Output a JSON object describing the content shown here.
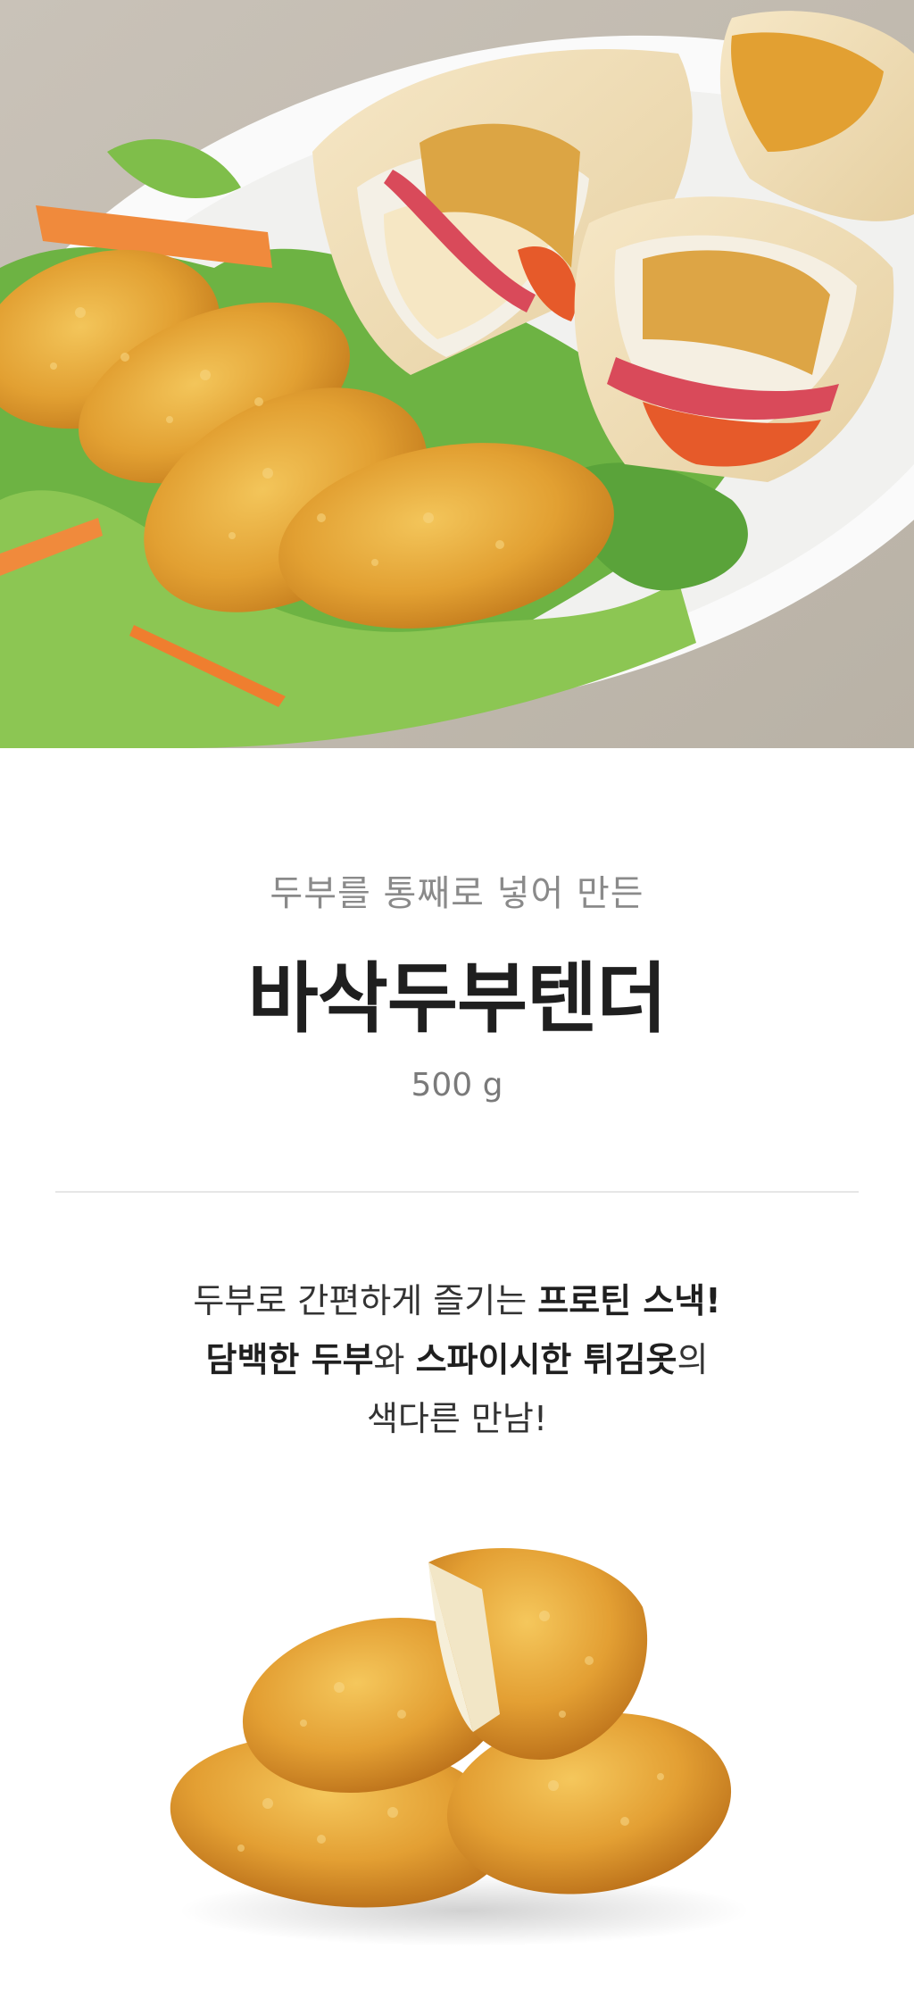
{
  "hero": {
    "image": "tofu-tender-wraps-salad-photo"
  },
  "product": {
    "subtitle": "두부를 통째로 넣어 만든",
    "title": "바삭두부텐더",
    "weight": "500 g"
  },
  "description": {
    "line1": [
      {
        "text": "두부로 간편하게 즐기는 ",
        "bold": false
      },
      {
        "text": "프로틴 스낵!",
        "bold": true
      }
    ],
    "line2": [
      {
        "text": "담백한 두부",
        "bold": true
      },
      {
        "text": "와 ",
        "bold": false
      },
      {
        "text": "스파이시한 튀김옷",
        "bold": true
      },
      {
        "text": "의",
        "bold": false
      }
    ],
    "line3": [
      {
        "text": "색다른 만남!",
        "bold": false
      }
    ]
  },
  "product_image": "fried-tofu-nuggets-photo",
  "colors": {
    "title": "#1f1f1f",
    "subtitle": "#8a8a8a",
    "nugget": "#e0a030",
    "lettuce": "#5aa33a"
  }
}
